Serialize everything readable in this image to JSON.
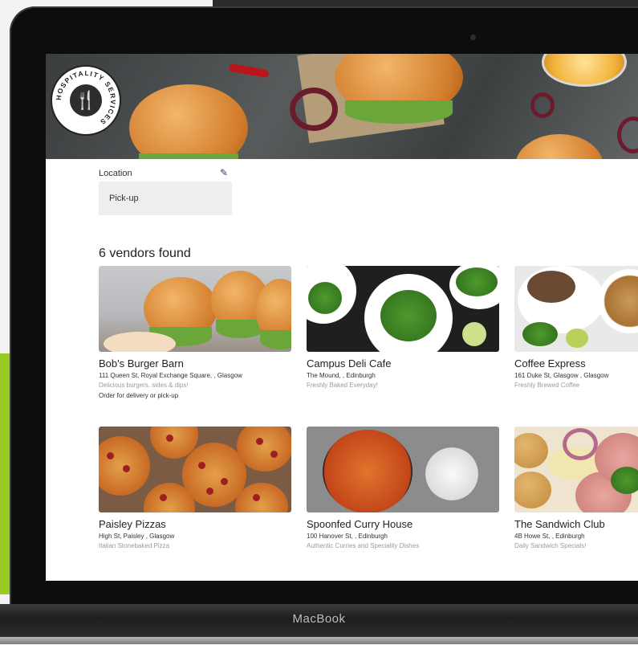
{
  "device": {
    "brand_label": "MacBook"
  },
  "header": {
    "logo_text": "HOSPITALITY SERVICES",
    "logo_icon": "cutlery-icon"
  },
  "location": {
    "label": "Location",
    "value": "Pick-up",
    "edit_icon": "pencil-icon"
  },
  "results": {
    "count_text": "6 vendors found"
  },
  "vendors": [
    {
      "name": "Bob's Burger Barn",
      "address": "111 Queen St, Royal Exchange Square, , Glasgow",
      "description": "Delicious burgers, sides & dips!",
      "extra": "Order for delivery or pick-up"
    },
    {
      "name": "Campus Deli Cafe",
      "address": "The Mound, , Edinburgh",
      "description": "Freshly Baked Everyday!"
    },
    {
      "name": "Coffee Express",
      "address": "161 Duke St, Glasgow , Glasgow",
      "description": "Freshly Brewed Coffee"
    },
    {
      "name": "Paisley Pizzas",
      "address": "High St, Paisley , Glasgow",
      "description": "Italian Stonebaked Pizza"
    },
    {
      "name": "Spoonfed Curry House",
      "address": "100 Hanover St, , Edinburgh",
      "description": "Authentic Curries and Speciality Dishes"
    },
    {
      "name": "The Sandwich Club",
      "address": "4B Howe St, , Edinburgh",
      "description": "Daily Sandwich Specials!"
    }
  ],
  "colors": {
    "accent_green": "#9acb22",
    "edit_icon": "#2a3f6b",
    "bezel": "#0d0d0d"
  }
}
